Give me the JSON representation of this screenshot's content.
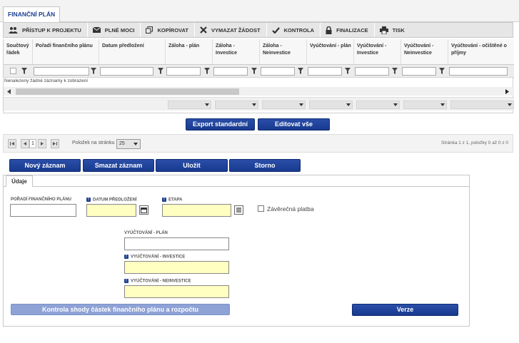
{
  "tab": "FINANČNÍ PLÁN",
  "toolbar": [
    {
      "label": "PŘÍSTUP K PROJEKTU",
      "icon": "users-icon"
    },
    {
      "label": "PLNÉ MOCI",
      "icon": "envelope-icon"
    },
    {
      "label": "KOPÍROVAT",
      "icon": "copy-icon"
    },
    {
      "label": "VYMAZAT ŽÁDOST",
      "icon": "close-icon"
    },
    {
      "label": "KONTROLA",
      "icon": "check-icon"
    },
    {
      "label": "FINALIZACE",
      "icon": "lock-icon"
    },
    {
      "label": "TISK",
      "icon": "printer-icon"
    }
  ],
  "grid": {
    "headers": [
      "Součtový řádek",
      "Pořadí finančního plánu",
      "Datum předložení",
      "Záloha - plán",
      "Záloha - Investice",
      "Záloha - Neinvestice",
      "Vyúčtování - plán",
      "Vyúčtování - Investice",
      "Vyúčtování - Neinvestice",
      "Vyúčtování - očištěné o příjmy"
    ],
    "empty": "Nenalezeny žádné záznamy k zobrazení"
  },
  "grid_buttons": {
    "export": "Export standardní",
    "edit_all": "Editovat vše"
  },
  "pager": {
    "page": "1",
    "per_page_label": "Položek na stránku",
    "per_page": "25",
    "summary": "Stránka 1 z 1, položky 0 až 0 z 0"
  },
  "actions": {
    "new": "Nový záznam",
    "delete": "Smazat záznam",
    "save": "Uložit",
    "cancel": "Storno"
  },
  "form": {
    "tab": "Údaje",
    "poradi": "POŘADÍ FINANČNÍHO PLÁNU",
    "datum": "DATUM PŘEDLOŽENÍ",
    "etapa": "ETAPA",
    "zaverecna": "Závěrečná platba",
    "vyu_plan": "VYÚČTOVÁNÍ - PLÁN",
    "vyu_inv": "VYÚČTOVÁNÍ - INVESTICE",
    "vyu_neinv": "VYÚČTOVÁNÍ - NEINVESTICE",
    "kontrola": "Kontrola shody částek finančního plánu a rozpočtu",
    "verze": "Verze",
    "req_mark": "!"
  }
}
